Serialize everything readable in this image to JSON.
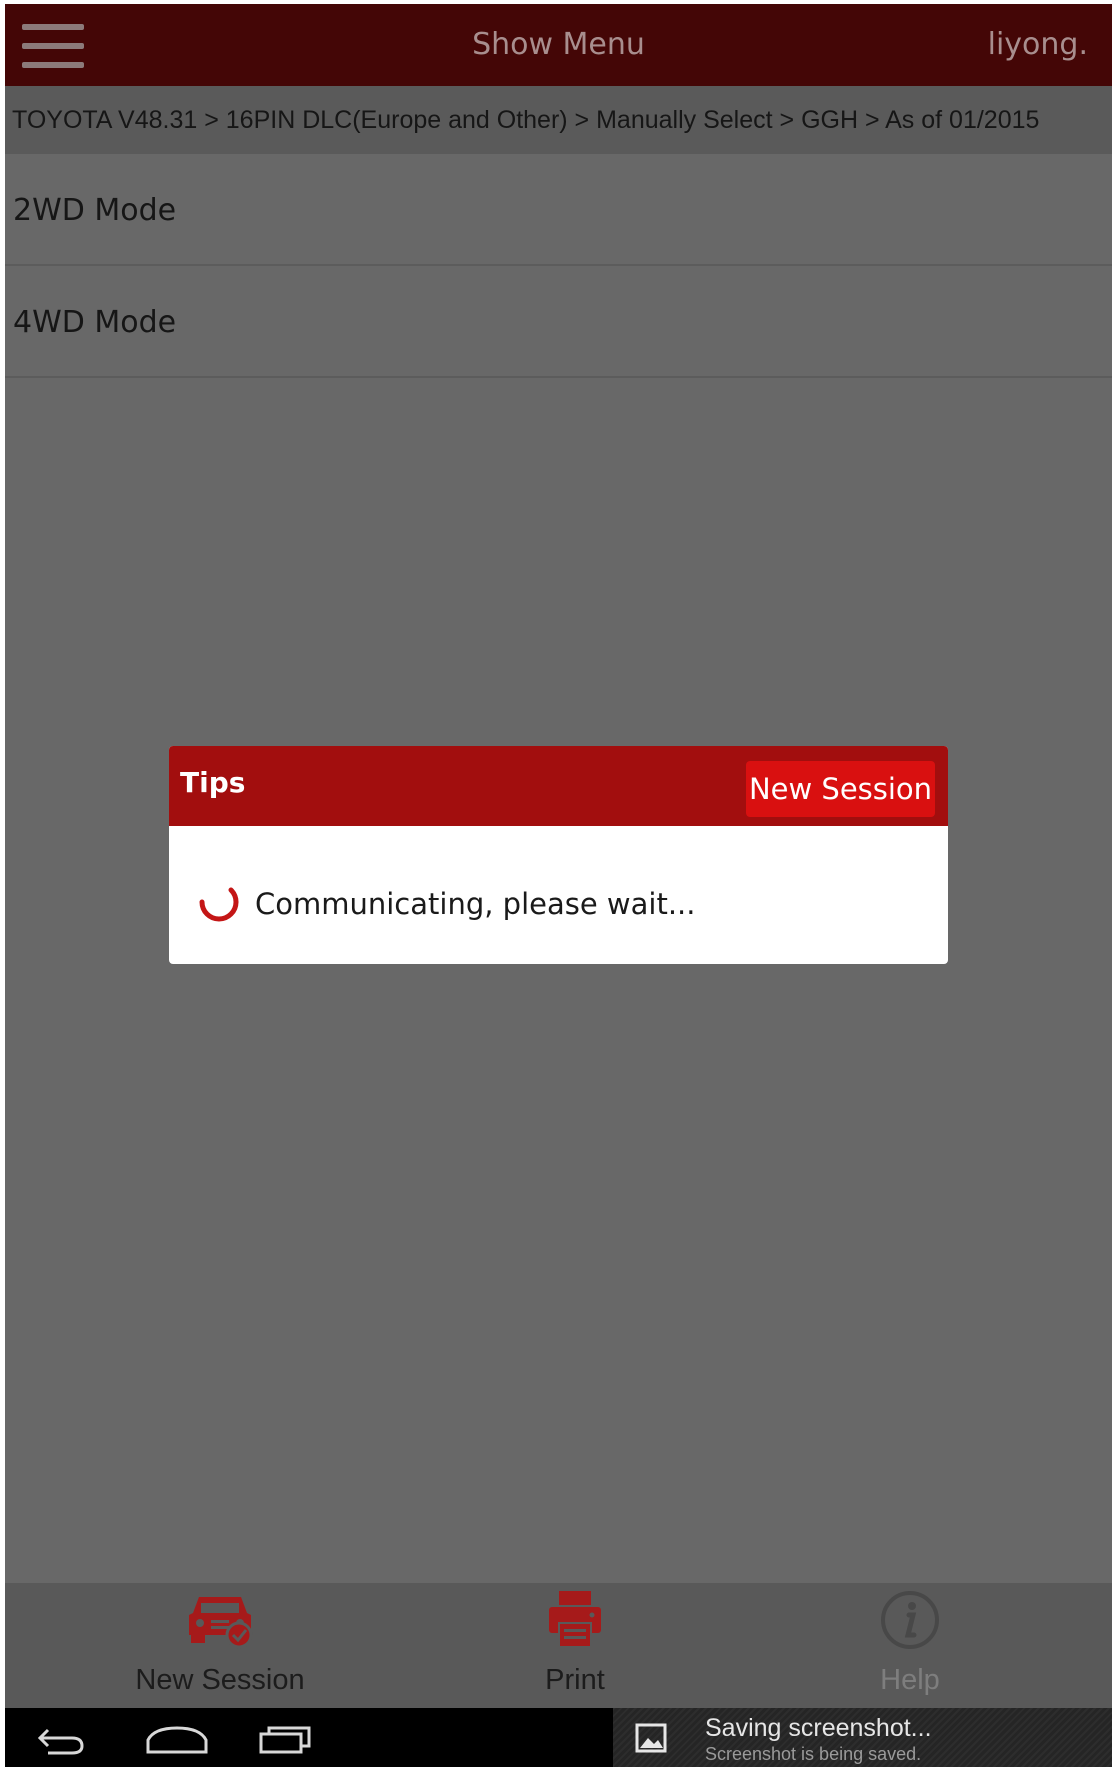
{
  "header": {
    "title": "Show Menu",
    "user": "liyong."
  },
  "breadcrumb": "TOYOTA V48.31 > 16PIN DLC(Europe and Other) > Manually Select > GGH > As of 01/2015",
  "modes": [
    {
      "label": "2WD Mode"
    },
    {
      "label": "4WD Mode"
    }
  ],
  "dialog": {
    "title": "Tips",
    "button_label": "New Session",
    "message": "Communicating, please wait...",
    "accent_color": "#a20e0e"
  },
  "toolbar": {
    "items": [
      {
        "label": "New Session",
        "icon": "car-check-icon"
      },
      {
        "label": "Print",
        "icon": "printer-icon"
      },
      {
        "label": "Help",
        "icon": "info-icon"
      }
    ]
  },
  "system_bar": {
    "notification_title": "Saving screenshot...",
    "notification_subtitle": "Screenshot is being saved."
  },
  "colors": {
    "header_bg": "#440606",
    "overlay_bg": "#686868",
    "brand_red": "#d91010"
  }
}
